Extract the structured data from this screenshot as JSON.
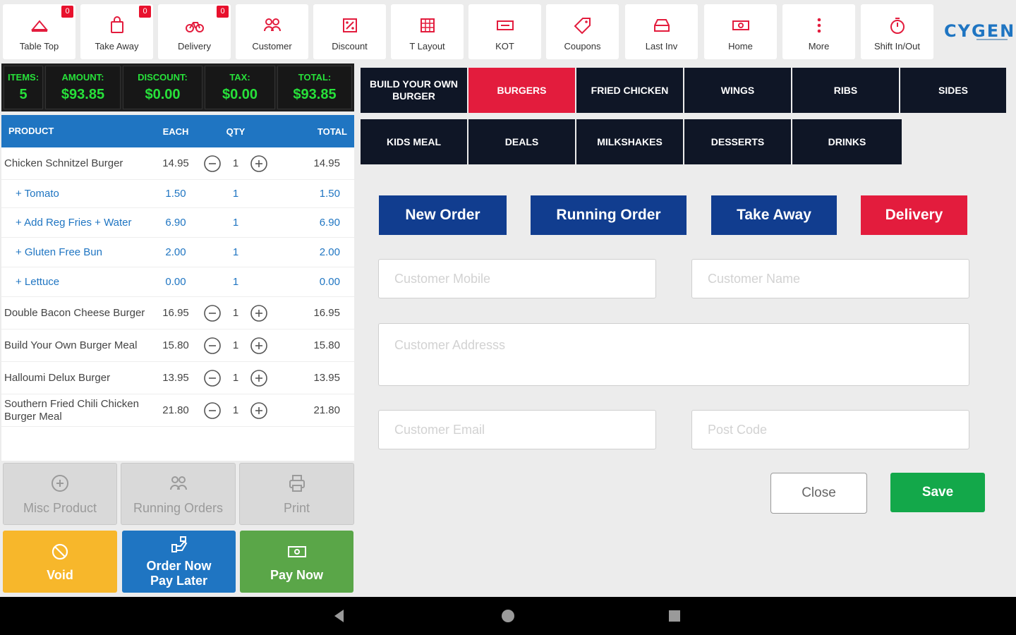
{
  "toolbar": {
    "items": [
      {
        "label": "Table Top",
        "icon": "table-top-icon",
        "badge": "0"
      },
      {
        "label": "Take Away",
        "icon": "shopping-bag-icon",
        "badge": "0"
      },
      {
        "label": "Delivery",
        "icon": "bicycle-icon",
        "badge": "0"
      },
      {
        "label": "Customer",
        "icon": "customers-icon"
      },
      {
        "label": "Discount",
        "icon": "discount-icon"
      },
      {
        "label": "T Layout",
        "icon": "grid-layout-icon"
      },
      {
        "label": "KOT",
        "icon": "ticket-icon"
      },
      {
        "label": "Coupons",
        "icon": "tag-icon"
      },
      {
        "label": "Last Inv",
        "icon": "invoice-icon"
      },
      {
        "label": "Home",
        "icon": "home-icon"
      },
      {
        "label": "More",
        "icon": "more-vertical-icon"
      },
      {
        "label": "Shift In/Out",
        "icon": "stopwatch-icon"
      }
    ],
    "logo": "CYGEN"
  },
  "summary": {
    "items_label": "ITEMS:",
    "items": "5",
    "amount_label": "AMOUNT:",
    "amount": "$93.85",
    "discount_label": "DISCOUNT:",
    "discount": "$0.00",
    "tax_label": "TAX:",
    "tax": "$0.00",
    "total_label": "TOTAL:",
    "total": "$93.85"
  },
  "order": {
    "headers": {
      "product": "PRODUCT",
      "each": "EACH",
      "qty": "QTY",
      "total": "TOTAL"
    },
    "rows": [
      {
        "name": "Chicken Schnitzel Burger",
        "each": "14.95",
        "qty": "1",
        "total": "14.95"
      },
      {
        "name": "+ Tomato",
        "each": "1.50",
        "qty": "1",
        "total": "1.50"
      },
      {
        "name": "+ Add Reg Fries + Water",
        "each": "6.90",
        "qty": "1",
        "total": "6.90"
      },
      {
        "name": "+ Gluten Free Bun",
        "each": "2.00",
        "qty": "1",
        "total": "2.00"
      },
      {
        "name": "+ Lettuce",
        "each": "0.00",
        "qty": "1",
        "total": "0.00"
      },
      {
        "name": "Double Bacon Cheese Burger",
        "each": "16.95",
        "qty": "1",
        "total": "16.95"
      },
      {
        "name": "Build Your Own Burger Meal",
        "each": "15.80",
        "qty": "1",
        "total": "15.80"
      },
      {
        "name": "Halloumi Delux Burger",
        "each": "13.95",
        "qty": "1",
        "total": "13.95"
      },
      {
        "name": "Southern Fried Chili Chicken Burger Meal",
        "each": "21.80",
        "qty": "1",
        "total": "21.80"
      }
    ]
  },
  "actions": {
    "misc": "Misc Product",
    "running": "Running Orders",
    "print": "Print",
    "void": "Void",
    "order_now": "Order Now",
    "pay_later": "Pay Later",
    "pay_now": "Pay Now"
  },
  "categories": {
    "row1": [
      "BUILD YOUR OWN BURGER",
      "BURGERS",
      "FRIED CHICKEN",
      "WINGS",
      "RIBS",
      "SIDES"
    ],
    "row2": [
      "KIDS MEAL",
      "DEALS",
      "MILKSHAKES",
      "DESSERTS",
      "DRINKS"
    ],
    "active": "BURGERS"
  },
  "order_type": {
    "new": "New Order",
    "running": "Running Order",
    "take_away": "Take Away",
    "delivery": "Delivery"
  },
  "form": {
    "mobile_placeholder": "Customer Mobile",
    "name_placeholder": "Customer Name",
    "address_placeholder": "Customer Addresss",
    "email_placeholder": "Customer Email",
    "postcode_placeholder": "Post Code",
    "close": "Close",
    "save": "Save"
  },
  "colors": {
    "brand_blue": "#1f75c2",
    "dark_navy": "#0f1626",
    "accent_red": "#e31c3d",
    "order_blue": "#113d8f",
    "green": "#13a84a",
    "amber": "#f7b72b",
    "summary_green": "#27e13a"
  }
}
